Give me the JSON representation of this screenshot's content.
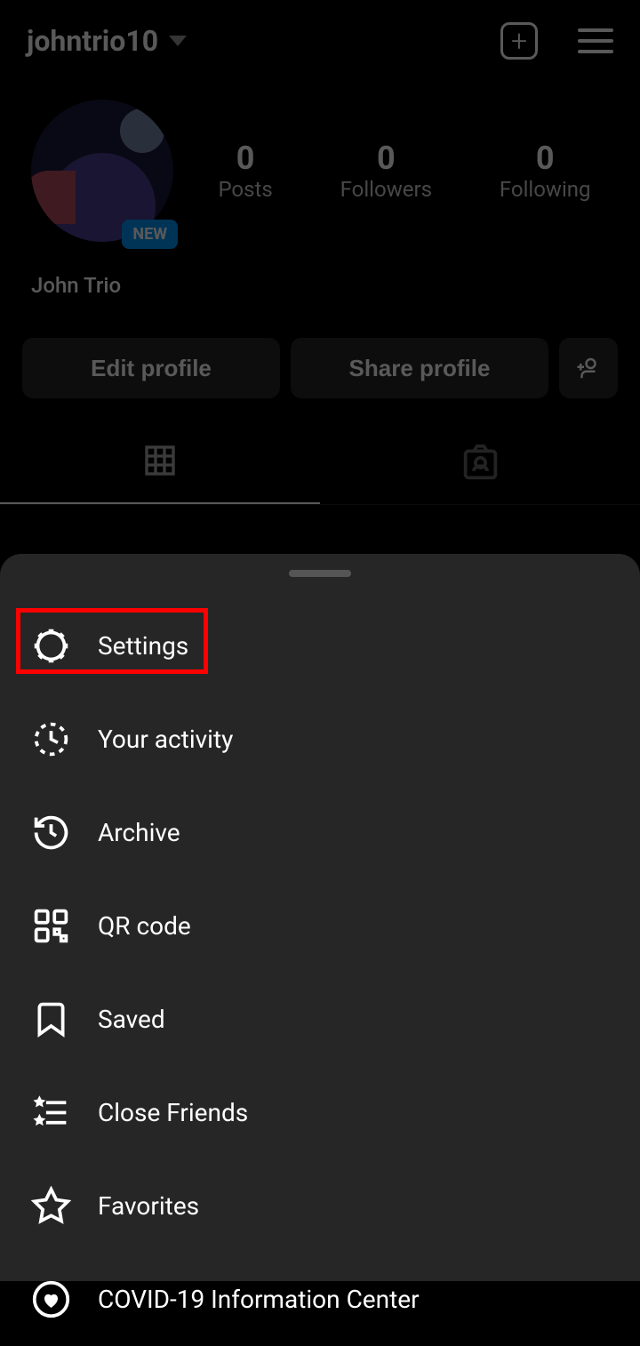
{
  "header": {
    "username": "johntrio10"
  },
  "profile": {
    "new_badge": "NEW",
    "display_name": "John Trio",
    "stats": {
      "posts": {
        "value": "0",
        "label": "Posts"
      },
      "followers": {
        "value": "0",
        "label": "Followers"
      },
      "following": {
        "value": "0",
        "label": "Following"
      }
    }
  },
  "actions": {
    "edit_profile": "Edit profile",
    "share_profile": "Share profile"
  },
  "menu": {
    "items": [
      {
        "label": "Settings"
      },
      {
        "label": "Your activity"
      },
      {
        "label": "Archive"
      },
      {
        "label": "QR code"
      },
      {
        "label": "Saved"
      },
      {
        "label": "Close Friends"
      },
      {
        "label": "Favorites"
      },
      {
        "label": "COVID-19 Information Center"
      }
    ]
  }
}
